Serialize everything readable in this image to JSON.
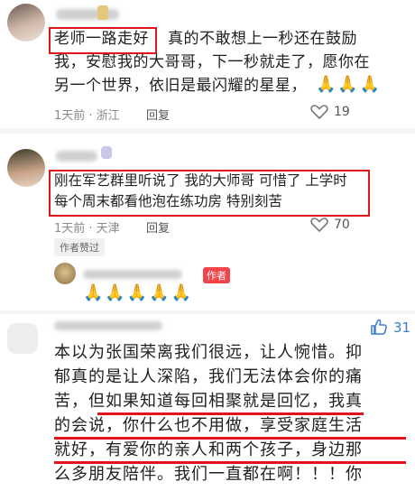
{
  "comments": [
    {
      "text_highlight": "老师一路走好",
      "text_line1_rest": "真的不敢想上一秒还在鼓励",
      "text_line2": "我，安慰我的大哥哥，下一秒就走了，愿你在",
      "text_line3": "另一个世界，依旧是最闪耀的星星，",
      "emoji": "🙏🙏🙏",
      "time_location": "1天前 · 浙江",
      "reply_label": "回复",
      "likes": "19"
    },
    {
      "text_line1": "刚在军艺群里听说了 我的大师哥 可惜了 上学时",
      "text_line2": "每个周末都看他泡在练功房 特别刻苦",
      "time_location": "1天前 · 天津",
      "reply_label": "回复",
      "likes": "70",
      "author_liked_badge": "作者赞过",
      "author_reply_tag": "作者",
      "author_reply_emoji": "🙏🙏🙏🙏🙏"
    },
    {
      "likes": "31",
      "lines": [
        "本以为张国荣离我们很远，让人惋惜。抑",
        "郁真的是让人深陷，我们无法体会你的痛",
        "苦，但如果知道每回相聚就是回忆，我真",
        "的会说，你什么也不用做，享受家庭生活",
        "就好，有爱你的亲人和两个孩子，身边那",
        "么多朋友陪伴。我们一直都在啊！！！你"
      ]
    }
  ],
  "icons": {
    "heart": "heart-icon",
    "thumb": "thumbs-up-icon",
    "pray": "praying-hands-emoji"
  },
  "colors": {
    "highlight_red": "#e0141b",
    "meta_gray": "#8a8a8a"
  }
}
